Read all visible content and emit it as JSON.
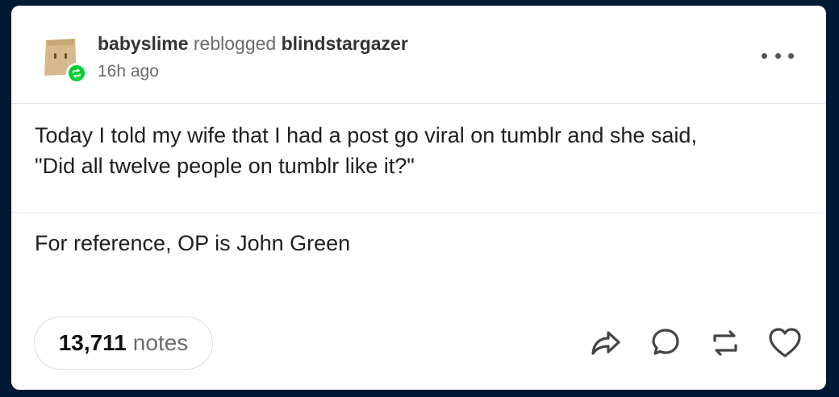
{
  "post": {
    "reblogger": "babyslime",
    "reblog_verb": "reblogged",
    "original_author": "blindstargazer",
    "timestamp": "16h ago",
    "body_line_1": "Today I told my wife that I had a post go viral on tumblr and she said,",
    "body_line_2": "\"Did all twelve people on tumblr like it?\"",
    "reblog_comment": "For reference, OP is John Green"
  },
  "footer": {
    "notes_count": "13,711",
    "notes_label": "notes"
  },
  "icons": {
    "avatar": "paper-bag-avatar",
    "badge": "reblog-icon",
    "more": "ellipsis-icon",
    "share": "share-icon",
    "reply": "reply-icon",
    "reblog": "reblog-icon",
    "like": "heart-icon"
  },
  "colors": {
    "page_background": "#001935",
    "card_background": "#ffffff",
    "reblog_badge": "#00cf35"
  }
}
